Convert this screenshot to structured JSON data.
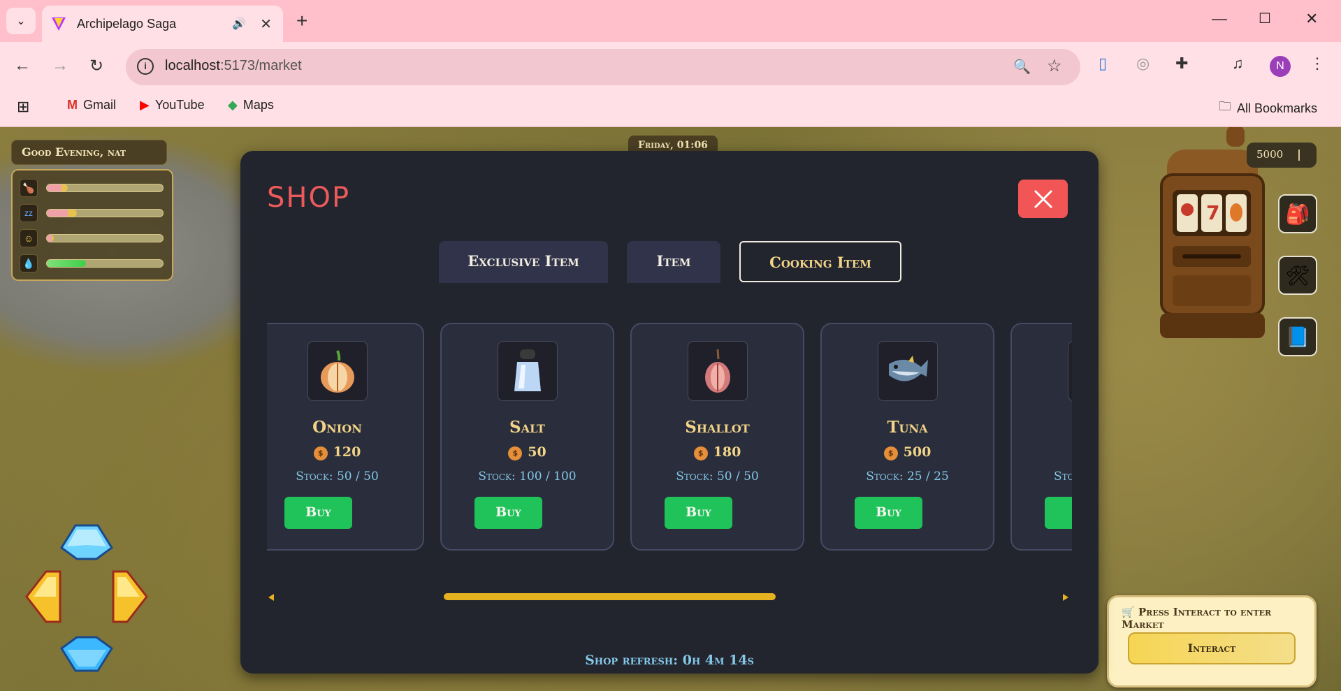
{
  "browser": {
    "tab_title": "Archipelago Saga",
    "url_host": "localhost",
    "url_path": ":5173/market",
    "avatar_letter": "N",
    "bookmarks": [
      "Gmail",
      "YouTube",
      "Maps"
    ],
    "all_bookmarks": "All Bookmarks"
  },
  "hud": {
    "greeting": "Good Evening, nat",
    "clock": "Friday, 01:06",
    "coins": "5000",
    "stats": [
      {
        "icon": "hunger-icon",
        "fill": 0.18,
        "color": "#e8c24a"
      },
      {
        "icon": "sleep-icon",
        "fill": 0.26,
        "color": "#e8c24a"
      },
      {
        "icon": "happiness-icon",
        "fill": 0.06,
        "color": "#e8c24a"
      },
      {
        "icon": "hygiene-icon",
        "fill": 0.34,
        "color": "#3fcf4a"
      }
    ],
    "market_hint": "Press Interact to enter Market",
    "interact_label": "Interact"
  },
  "shop": {
    "title": "SHOP",
    "tabs": [
      "Exclusive Item",
      "Item",
      "Cooking Item"
    ],
    "active_tab": "Cooking Item",
    "items": [
      {
        "name": "Onion",
        "price": "120",
        "stock": "Stock: 50 / 50",
        "buy": "Buy"
      },
      {
        "name": "Salt",
        "price": "50",
        "stock": "Stock: 100 / 100",
        "buy": "Buy"
      },
      {
        "name": "Shallot",
        "price": "180",
        "stock": "Stock: 50 / 50",
        "buy": "Buy"
      },
      {
        "name": "Tuna",
        "price": "500",
        "stock": "Stock: 25 / 25",
        "buy": "Buy"
      },
      {
        "name": "",
        "price": "",
        "stock": "Sto",
        "buy": ""
      }
    ],
    "refresh": "Shop refresh: 0h 4m 14s"
  },
  "colors": {
    "accent_red": "#f25555",
    "buy_green": "#1fc35a",
    "gold_text": "#f2d488",
    "stock_blue": "#84c8e8"
  }
}
